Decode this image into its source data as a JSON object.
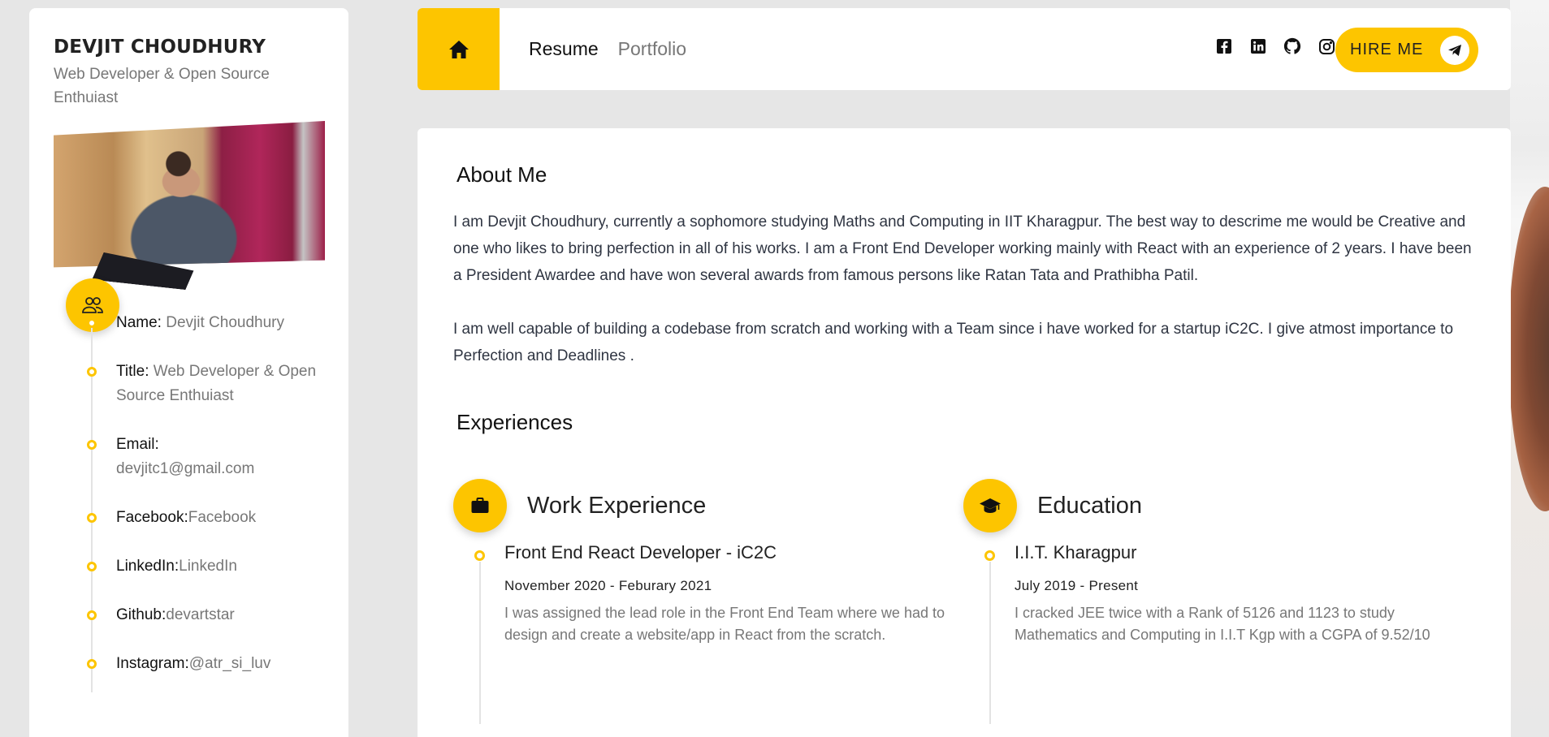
{
  "profile": {
    "name": "DEVJIT CHOUDHURY",
    "title": "Web Developer & Open Source Enthuiast",
    "info": [
      {
        "key": "Name: ",
        "value": "Devjit Choudhury"
      },
      {
        "key": "Title: ",
        "value": "Web Developer & Open Source Enthuiast"
      },
      {
        "key": "Email: ",
        "value": "devjitc1@gmail.com"
      },
      {
        "key": "Facebook:",
        "value": "Facebook"
      },
      {
        "key": "LinkedIn:",
        "value": "LinkedIn"
      },
      {
        "key": "Github:",
        "value": "devartstar"
      },
      {
        "key": "Instagram:",
        "value": "@atr_si_luv"
      }
    ]
  },
  "nav": {
    "home_icon": "home-icon",
    "links": [
      "Resume",
      "Portfolio"
    ],
    "socials": [
      "facebook-icon",
      "linkedin-icon",
      "github-icon",
      "instagram-icon"
    ],
    "hire_label": "HIRE ME",
    "hire_icon": "telegram-icon"
  },
  "about": {
    "heading": "About Me",
    "paragraphs": [
      "I am Devjit Choudhury, currently a sophomore studying Maths and Computing in IIT Kharagpur. The best way to descrime me would be Creative and one who likes to bring perfection in all of his works. I am a Front End Developer working mainly with React with an experience of 2 years. I have been a President Awardee and have won several awards from famous persons like Ratan Tata and Prathibha Patil.",
      "I am well capable of building a codebase from scratch and working with a Team since i have worked for a startup iC2C. I give atmost importance to Perfection and Deadlines ."
    ]
  },
  "experiences": {
    "heading": "Experiences",
    "work": {
      "heading": "Work Experience",
      "icon": "briefcase-icon",
      "items": [
        {
          "title": "Front End React Developer - iC2C",
          "date": "November 2020 - Feburary 2021",
          "desc": "I was assigned the lead role in the Front End Team where we had to design and create a website/app in React from the scratch."
        }
      ]
    },
    "education": {
      "heading": "Education",
      "icon": "graduation-cap-icon",
      "items": [
        {
          "title": "I.I.T. Kharagpur",
          "date": "July 2019 - Present",
          "desc": "I cracked JEE twice with a Rank of 5126 and 1123 to study Mathematics and Computing in I.I.T Kgp with a CGPA of 9.52/10"
        }
      ]
    }
  },
  "colors": {
    "accent": "#fdc500",
    "highlight": "#fde79a",
    "background": "#e6e6e6"
  }
}
